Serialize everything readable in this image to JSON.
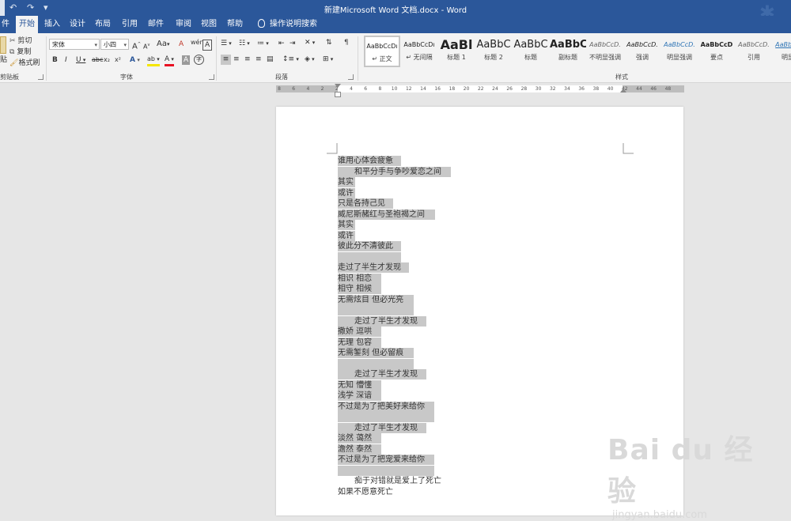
{
  "title": "新建Microsoft Word 文档.docx  -  Word",
  "quick_access": {
    "undo": "↶",
    "redo": "↷",
    "customize": "▾"
  },
  "tabs": [
    {
      "label": "件",
      "active": false
    },
    {
      "label": "开始",
      "active": true
    },
    {
      "label": "插入",
      "active": false
    },
    {
      "label": "设计",
      "active": false
    },
    {
      "label": "布局",
      "active": false
    },
    {
      "label": "引用",
      "active": false
    },
    {
      "label": "邮件",
      "active": false
    },
    {
      "label": "审阅",
      "active": false
    },
    {
      "label": "视图",
      "active": false
    },
    {
      "label": "帮助",
      "active": false
    }
  ],
  "tell_me": "操作说明搜索",
  "clipboard": {
    "paste": "贴",
    "cut": "剪切",
    "copy": "复制",
    "format_painter": "格式刷",
    "group": "剪贴板"
  },
  "font": {
    "name": "宋体",
    "size": "小四",
    "group": "字体",
    "grow": "A",
    "shrink": "A",
    "case": "Aa",
    "clear": "A",
    "phonetic": "wén",
    "border_char": "A",
    "bold": "B",
    "italic": "I",
    "underline": "U",
    "strike": "abc",
    "subscript": "x₂",
    "superscript": "x²",
    "effects": "A",
    "highlight": "ab",
    "color": "A",
    "shading": "A",
    "enclose": "字"
  },
  "paragraph": {
    "group": "段落"
  },
  "styles": {
    "group": "样式",
    "items": [
      {
        "sample": "AaBbCcDı",
        "name": "↵ 正文",
        "selected": true,
        "style": "normal"
      },
      {
        "sample": "AaBbCcDı",
        "name": "↵ 无间隔",
        "selected": false,
        "style": "normal"
      },
      {
        "sample": "AaBl",
        "name": "标题 1",
        "selected": false,
        "style": "h1"
      },
      {
        "sample": "AaBbC",
        "name": "标题 2",
        "selected": false,
        "style": "h2"
      },
      {
        "sample": "AaBbC",
        "name": "标题",
        "selected": false,
        "style": "h2"
      },
      {
        "sample": "AaBbC",
        "name": "副标题",
        "selected": false,
        "style": "sub"
      },
      {
        "sample": "AaBbCcD.",
        "name": "不明显强调",
        "selected": false,
        "style": "italic-gray"
      },
      {
        "sample": "AaBbCcD.",
        "name": "强调",
        "selected": false,
        "style": "italic"
      },
      {
        "sample": "AaBbCcD.",
        "name": "明显强调",
        "selected": false,
        "style": "italic-blue"
      },
      {
        "sample": "AaBbCcD",
        "name": "要点",
        "selected": false,
        "style": "bold"
      },
      {
        "sample": "AaBbCcD.",
        "name": "引用",
        "selected": false,
        "style": "italic-gray"
      },
      {
        "sample": "AaBbCcD.",
        "name": "明显引",
        "selected": false,
        "style": "italic-blue-u"
      }
    ]
  },
  "ruler": {
    "labels": [
      "8",
      "6",
      "4",
      "2",
      "2",
      "4",
      "6",
      "8",
      "10",
      "12",
      "14",
      "16",
      "18",
      "20",
      "22",
      "24",
      "26",
      "28",
      "30",
      "32",
      "34",
      "36",
      "38",
      "40",
      "42",
      "44",
      "46",
      "48"
    ]
  },
  "document": {
    "lines": [
      {
        "text": "谁用心体会疲惫",
        "indent": 0,
        "hl_width": 80
      },
      {
        "text": "和平分手与争吵爱恋之间",
        "indent": 1,
        "hl_width": 143
      },
      {
        "text": "其实",
        "indent": 0,
        "hl_width": 22
      },
      {
        "text": "或许",
        "indent": 0,
        "hl_width": 22
      },
      {
        "text": "只是各持己见",
        "indent": 0,
        "hl_width": 70
      },
      {
        "text": "威尼斯赭红与圣袍褐之间",
        "indent": 0,
        "hl_width": 123
      },
      {
        "text": "其实",
        "indent": 0,
        "hl_width": 22
      },
      {
        "text": "或许",
        "indent": 0,
        "hl_width": 22
      },
      {
        "text": "彼此分不清彼此",
        "indent": 0,
        "hl_width": 80
      },
      {
        "text": "",
        "indent": 0,
        "hl_width": 80
      },
      {
        "text": "走过了半生才发现",
        "indent": 0,
        "hl_width": 90
      },
      {
        "text": "相识 相恋",
        "indent": 0,
        "hl_width": 55
      },
      {
        "text": "相守 相候",
        "indent": 0,
        "hl_width": 55
      },
      {
        "text": "无需炫目 但必光亮",
        "indent": 0,
        "hl_width": 96
      },
      {
        "text": "",
        "indent": 0,
        "hl_width": 96
      },
      {
        "text": "走过了半生才发现",
        "indent": 1,
        "hl_width": 112
      },
      {
        "text": "撒娇 逗哄",
        "indent": 0,
        "hl_width": 55
      },
      {
        "text": "无理 包容",
        "indent": 0,
        "hl_width": 55
      },
      {
        "text": "无需錾刻 但必留痕",
        "indent": 0,
        "hl_width": 96
      },
      {
        "text": "",
        "indent": 0,
        "hl_width": 96
      },
      {
        "text": "走过了半生才发现",
        "indent": 1,
        "hl_width": 112
      },
      {
        "text": "无知 懵懂",
        "indent": 0,
        "hl_width": 55
      },
      {
        "text": "浅学 深谙",
        "indent": 0,
        "hl_width": 55
      },
      {
        "text": "不过是为了把美好来给你",
        "indent": 0,
        "hl_width": 122
      },
      {
        "text": "",
        "indent": 0,
        "hl_width": 122
      },
      {
        "text": "走过了半生才发现",
        "indent": 1,
        "hl_width": 112
      },
      {
        "text": "淡然 蔼然",
        "indent": 0,
        "hl_width": 55
      },
      {
        "text": "澹然 泰然",
        "indent": 0,
        "hl_width": 55
      },
      {
        "text": "不过是为了把宠爱来给你",
        "indent": 0,
        "hl_width": 122
      },
      {
        "text": "",
        "indent": 0,
        "hl_width": 122
      },
      {
        "text": "痴于对错就是爱上了死亡",
        "indent": 1,
        "hl_width": 0
      },
      {
        "text": "如果不愿意死亡",
        "indent": 0,
        "hl_width": 0
      }
    ]
  },
  "watermark": {
    "main": "Bai du 经验",
    "sub": "jingyan.baidu.com"
  },
  "colors": {
    "accent": "#2b579a",
    "highlight": "#c8c8c8",
    "page_bg": "#e6e6e6"
  }
}
